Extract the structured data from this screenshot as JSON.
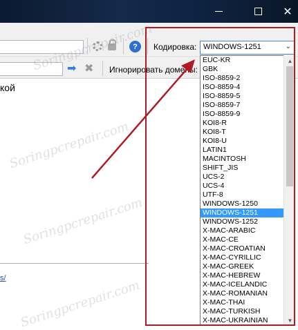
{
  "watermark": "Soringpcrepair.com",
  "encoding": {
    "label": "Кодировка:",
    "selected": "WINDOWS-1251",
    "options": [
      "EUC-KR",
      "GBK",
      "ISO-8859-2",
      "ISO-8859-4",
      "ISO-8859-5",
      "ISO-8859-7",
      "ISO-8859-9",
      "KOI8-R",
      "KOI8-T",
      "KOI8-U",
      "LATIN1",
      "MACINTOSH",
      "SHIFT_JIS",
      "UCS-2",
      "UCS-4",
      "UTF-8",
      "WINDOWS-1250",
      "WINDOWS-1251",
      "WINDOWS-1252",
      "X-MAC-ARABIC",
      "X-MAC-CE",
      "X-MAC-CROATIAN",
      "X-MAC-CYRILLIC",
      "X-MAC-GREEK",
      "X-MAC-HEBREW",
      "X-MAC-ICELANDIC",
      "X-MAC-ROMANIAN",
      "X-MAC-THAI",
      "X-MAC-TURKISH",
      "X-MAC-UKRAINIAN"
    ]
  },
  "toolbar": {
    "ignore_domains_label": "Игнорировать домены:",
    "help_glyph": "?",
    "go_glyph": "➡",
    "stop_glyph": "✖"
  },
  "content": {
    "fragment": "кой",
    "link_fragment": "s/"
  },
  "colors": {
    "annotation_red": "#b01a22",
    "selection_blue": "#3399ff"
  }
}
